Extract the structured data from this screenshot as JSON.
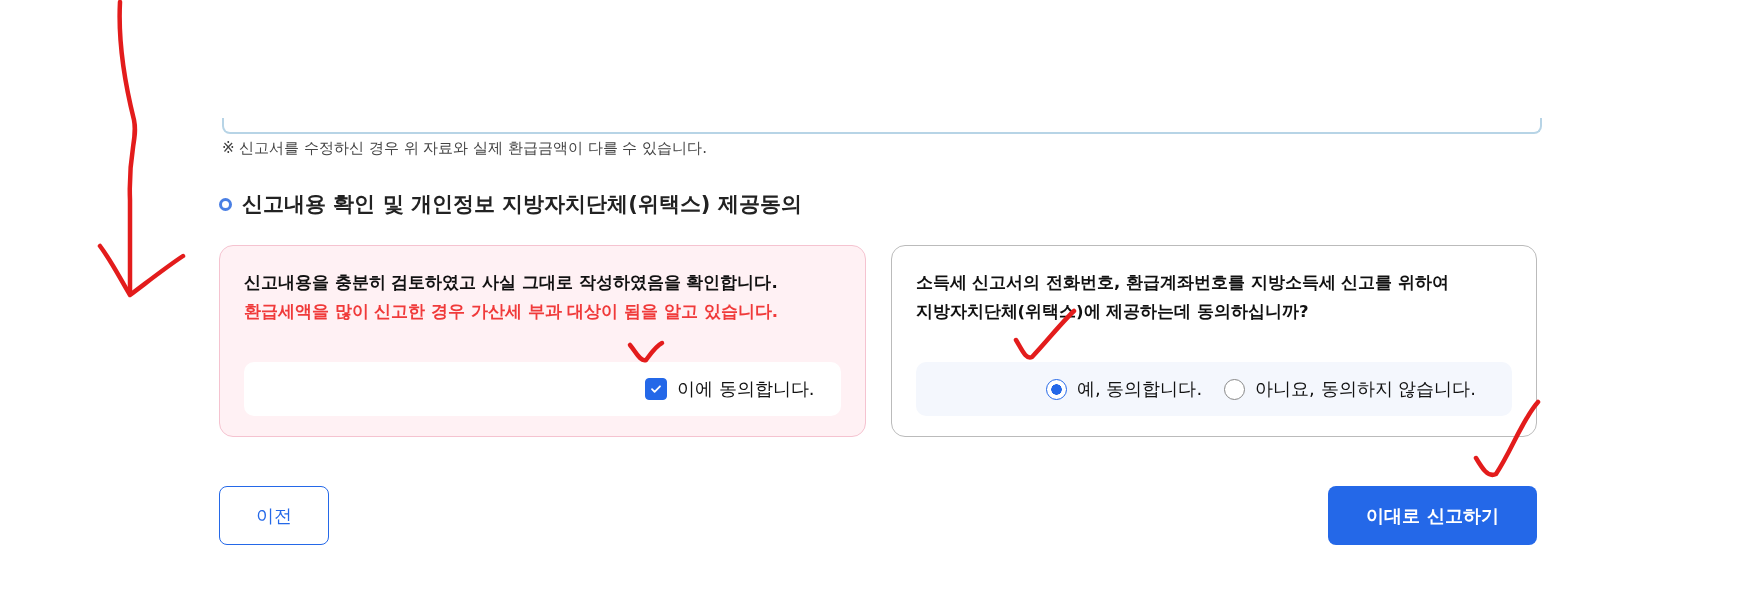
{
  "note": "※ 신고서를 수정하신 경우 위 자료와 실제 환급금액이 다를 수 있습니다.",
  "section_title": "신고내용 확인 및 개인정보 지방자치단체(위택스) 제공동의",
  "confirm_card": {
    "lines": [
      {
        "text": "신고내용을 충분히 검토하였고 사실 그대로 작성하였음을 확인합니다.",
        "kind": "normal"
      },
      {
        "text": "환급세액을 많이 신고한 경우 가산세 부과 대상이 됨을 알고 있습니다.",
        "kind": "warning"
      }
    ],
    "checkbox": {
      "label": "이에 동의합니다.",
      "checked": true
    }
  },
  "consent_card": {
    "lines": [
      "소득세 신고서의 전화번호, 환급계좌번호를 지방소득세 신고를 위하여",
      "지방자치단체(위택스)에 제공하는데 동의하십니까?"
    ],
    "options": [
      {
        "label": "예, 동의합니다.",
        "selected": true
      },
      {
        "label": "아니요, 동의하지 않습니다.",
        "selected": false
      }
    ]
  },
  "buttons": [
    {
      "label": "이전",
      "kind": "secondary"
    },
    {
      "label": "이대로 신고하기",
      "kind": "primary"
    }
  ]
}
